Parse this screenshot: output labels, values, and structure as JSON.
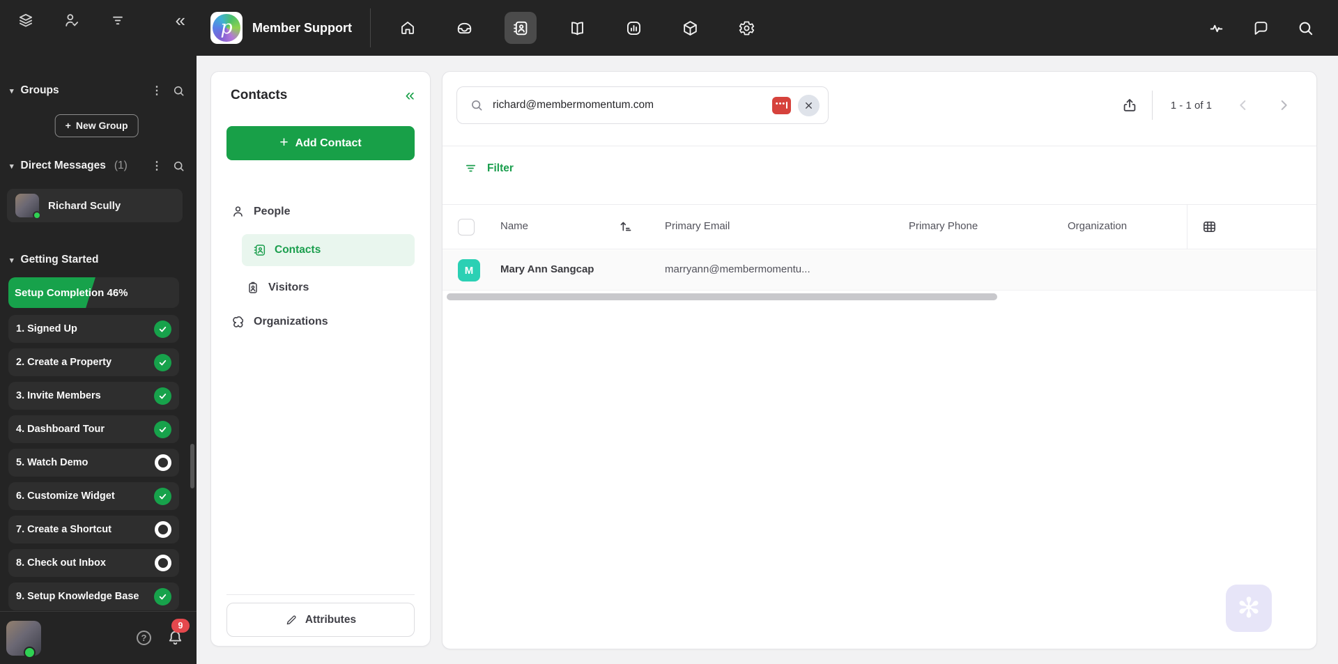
{
  "header": {
    "workspace_name": "Member Support",
    "nav": [
      "home",
      "inbox",
      "contacts",
      "knowledge-base",
      "reports",
      "integrations",
      "settings"
    ],
    "right_icons": [
      "activity",
      "chat",
      "search"
    ]
  },
  "sidebar": {
    "top_icons": [
      "layers",
      "user-check",
      "filter-lines",
      "collapse"
    ],
    "collapse_glyph": "«",
    "caret_glyph": "▾",
    "kebab_glyph": "⋮",
    "groups": {
      "label": "Groups",
      "new_group_label": "New Group",
      "plus_glyph": "+"
    },
    "direct_messages": {
      "label": "Direct Messages",
      "count": "(1)",
      "items": [
        {
          "name": "Richard Scully",
          "online": true
        }
      ]
    },
    "getting_started": {
      "label": "Getting Started",
      "setup_completion_label": "Setup Completion 46%",
      "percent": 46,
      "steps": [
        {
          "label": "1. Signed Up",
          "done": true
        },
        {
          "label": "2. Create a Property",
          "done": true
        },
        {
          "label": "3. Invite Members",
          "done": true
        },
        {
          "label": "4. Dashboard Tour",
          "done": true
        },
        {
          "label": "5. Watch Demo",
          "done": false
        },
        {
          "label": "6. Customize Widget",
          "done": true
        },
        {
          "label": "7. Create a Shortcut",
          "done": false
        },
        {
          "label": "8. Check out Inbox",
          "done": false
        },
        {
          "label": "9. Setup Knowledge Base",
          "done": true
        }
      ]
    },
    "bottom": {
      "help_glyph": "?",
      "notification_count": "9"
    }
  },
  "contacts_panel": {
    "title": "Contacts",
    "collapse_glyph": "«",
    "add_contact_label": "Add Contact",
    "plus_glyph": "+",
    "menu": {
      "people": "People",
      "contacts": "Contacts",
      "visitors": "Visitors",
      "organizations": "Organizations"
    },
    "attributes_label": "Attributes"
  },
  "main": {
    "search": {
      "value": "richard@membermomentum.com"
    },
    "password_manager_dots": "•••",
    "pagination": {
      "range": "1 - 1 of 1"
    },
    "filter_label": "Filter",
    "table": {
      "columns": {
        "name": "Name",
        "email": "Primary Email",
        "phone": "Primary Phone",
        "organization": "Organization"
      },
      "rows": [
        {
          "initial": "M",
          "name": "Mary Ann Sangcap",
          "email": "marryann@membermomentu...",
          "phone": "",
          "organization": "",
          "avatar_color": "#2bd0b4"
        }
      ]
    },
    "widget_glyph": "✻"
  },
  "colors": {
    "accent_green": "#18a048",
    "dark_surface": "#242424",
    "dark_item": "#2e2e2e",
    "avatar_teal": "#2bd0b4",
    "badge_red": "#e5484d",
    "password_icon_red": "#d6423c",
    "widget_lavender": "#e7e5f8",
    "active_item_bg": "#e9f6ee"
  }
}
